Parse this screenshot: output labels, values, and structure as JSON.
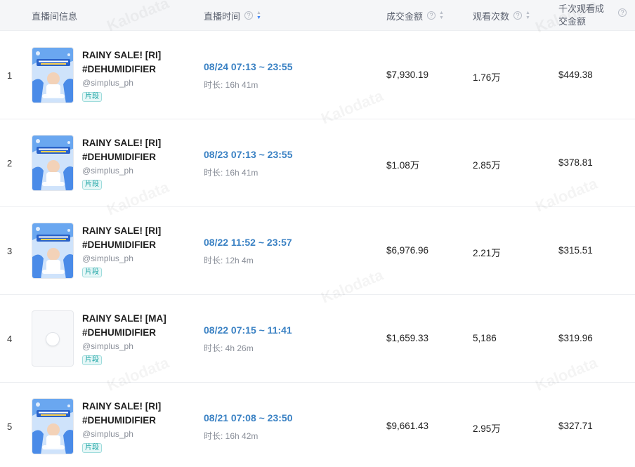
{
  "header": {
    "info": "直播间信息",
    "time": "直播时间",
    "gmv": "成交金额",
    "views": "观看次数",
    "gpm": "千次观看成交金额",
    "help_glyph": "?"
  },
  "watermark": "Kalodata",
  "rows": [
    {
      "index": "1",
      "title": "RAINY SALE! [RI] #DEHUMIDIFIER",
      "handle": "@simplus_ph",
      "tag": "片段",
      "time": "08/24 07:13 ~ 23:55",
      "duration": "时长: 16h 41m",
      "gmv": "$7,930.19",
      "views": "1.76万",
      "gpm": "$449.38",
      "thumb": "promo"
    },
    {
      "index": "2",
      "title": "RAINY SALE! [RI] #DEHUMIDIFIER",
      "handle": "@simplus_ph",
      "tag": "片段",
      "time": "08/23 07:13 ~ 23:55",
      "duration": "时长: 16h 41m",
      "gmv": "$1.08万",
      "views": "2.85万",
      "gpm": "$378.81",
      "thumb": "promo"
    },
    {
      "index": "3",
      "title": "RAINY SALE! [RI] #DEHUMIDIFIER",
      "handle": "@simplus_ph",
      "tag": "片段",
      "time": "08/22 11:52 ~ 23:57",
      "duration": "时长: 12h 4m",
      "gmv": "$6,976.96",
      "views": "2.21万",
      "gpm": "$315.51",
      "thumb": "promo"
    },
    {
      "index": "4",
      "title": "RAINY SALE! [MA] #DEHUMIDIFIER",
      "handle": "@simplus_ph",
      "tag": "片段",
      "time": "08/22 07:15 ~ 11:41",
      "duration": "时长: 4h 26m",
      "gmv": "$1,659.33",
      "views": "5,186",
      "gpm": "$319.96",
      "thumb": "placeholder"
    },
    {
      "index": "5",
      "title": "RAINY SALE! [RI] #DEHUMIDIFIER",
      "handle": "@simplus_ph",
      "tag": "片段",
      "time": "08/21 07:08 ~ 23:50",
      "duration": "时长: 16h 42m",
      "gmv": "$9,661.43",
      "views": "2.95万",
      "gpm": "$327.71",
      "thumb": "promo"
    }
  ],
  "colors": {
    "time_text": "#3b82c4",
    "tag_text": "#17a2a2",
    "header_bg": "#f5f6f8",
    "sort_active": "#3b82f6"
  }
}
